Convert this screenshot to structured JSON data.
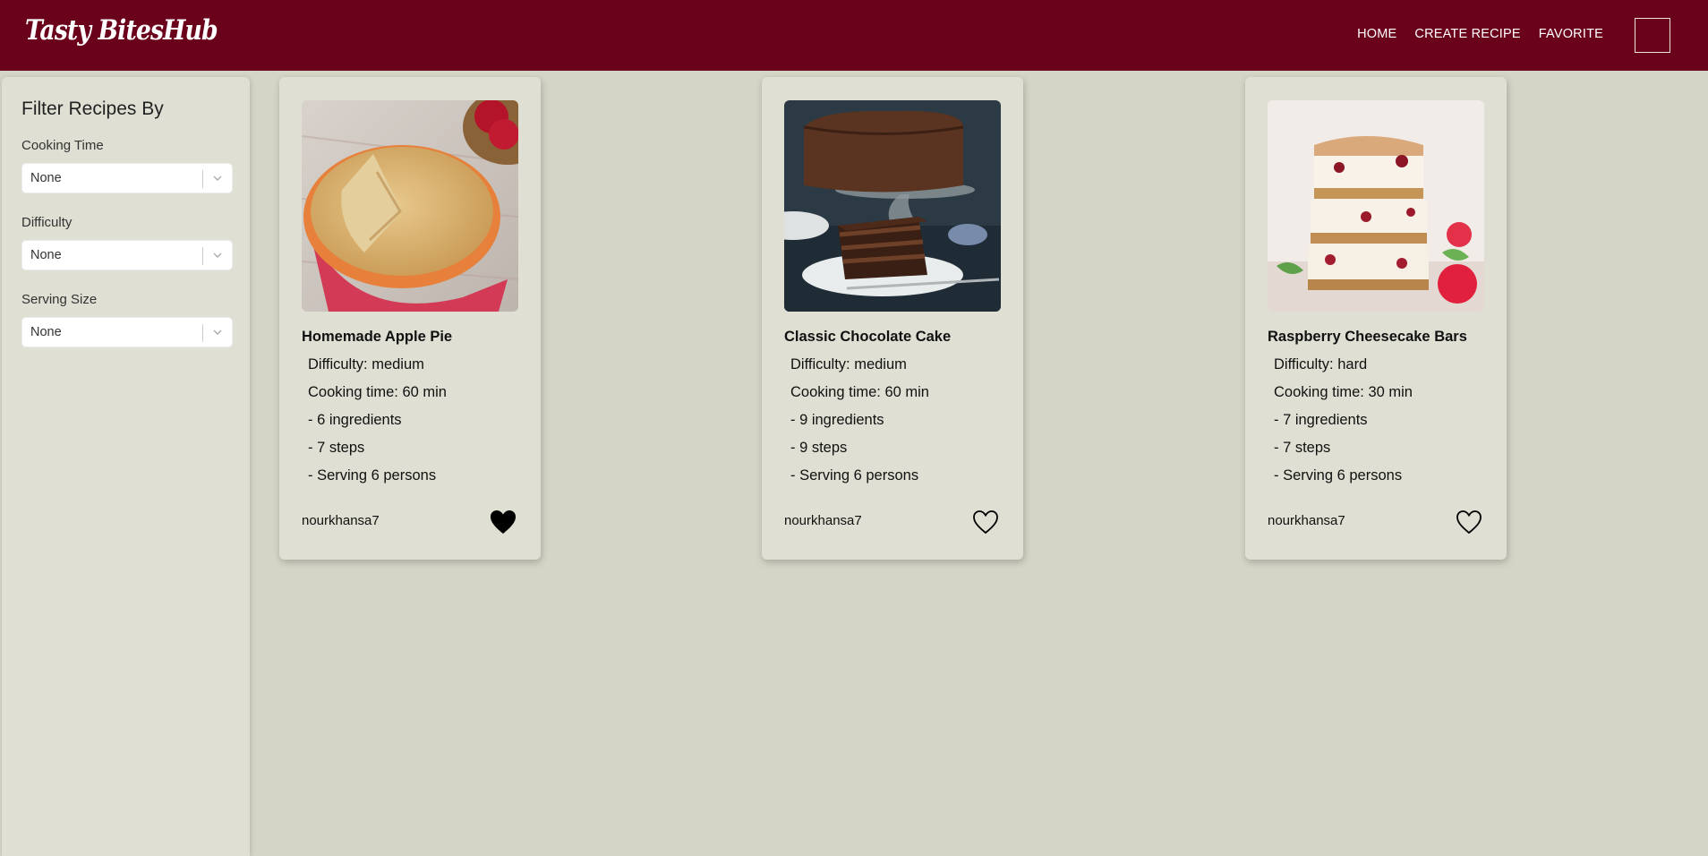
{
  "header": {
    "logo_text": "Tasty BitesHub",
    "nav": [
      "HOME",
      "CREATE RECIPE",
      "FAVORITE"
    ],
    "brand_color": "#6b021b"
  },
  "sidebar": {
    "title": "Filter Recipes By",
    "filters": [
      {
        "label": "Cooking Time",
        "value": "None"
      },
      {
        "label": "Difficulty",
        "value": "None"
      },
      {
        "label": "Serving Size",
        "value": "None"
      }
    ]
  },
  "recipes": [
    {
      "title": "Homemade Apple Pie",
      "difficulty": "Difficulty: medium",
      "cooking_time": "Cooking time: 60 min",
      "ingredients": "- 6 ingredients",
      "steps": "- 7 steps",
      "serving": "- Serving 6 persons",
      "author": "nourkhansa7",
      "favorited": true,
      "image": "apple-pie-photo"
    },
    {
      "title": "Classic Chocolate Cake",
      "difficulty": "Difficulty: medium",
      "cooking_time": "Cooking time: 60 min",
      "ingredients": "- 9 ingredients",
      "steps": "- 9 steps",
      "serving": "- Serving 6 persons",
      "author": "nourkhansa7",
      "favorited": false,
      "image": "chocolate-cake-photo"
    },
    {
      "title": "Raspberry Cheesecake Bars",
      "difficulty": "Difficulty: hard",
      "cooking_time": "Cooking time: 30 min",
      "ingredients": "- 7 ingredients",
      "steps": "- 7 steps",
      "serving": "- Serving 6 persons",
      "author": "nourkhansa7",
      "favorited": false,
      "image": "cheesecake-photo"
    }
  ]
}
